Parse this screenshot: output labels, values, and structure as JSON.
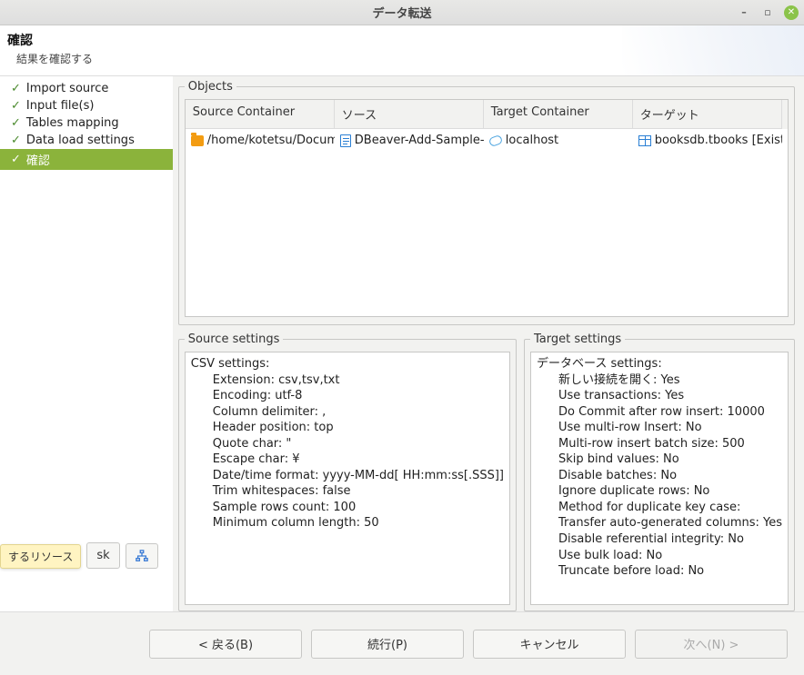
{
  "window": {
    "title": "データ転送"
  },
  "header": {
    "title": "確認",
    "subtitle": "結果を確認する"
  },
  "sidebar": {
    "items": [
      {
        "label": "Import source",
        "active": false
      },
      {
        "label": "Input file(s)",
        "active": false
      },
      {
        "label": "Tables mapping",
        "active": false
      },
      {
        "label": "Data load settings",
        "active": false
      },
      {
        "label": "確認",
        "active": true
      }
    ],
    "tooltip": "するリソース",
    "sk_button": "sk",
    "tool_icon": "sitemap-icon"
  },
  "objects": {
    "legend": "Objects",
    "columns": [
      "Source Container",
      "ソース",
      "Target Container",
      "ターゲット"
    ],
    "rows": [
      {
        "source_container": "/home/kotetsu/Docum",
        "source": "DBeaver-Add-Sample-",
        "target_container": "localhost",
        "target": "booksdb.tbooks [Existin"
      }
    ]
  },
  "source_settings": {
    "legend": "Source settings",
    "title": "CSV settings:",
    "lines": [
      "Extension: csv,tsv,txt",
      "Encoding: utf-8",
      "Column delimiter: ,",
      "Header position: top",
      "Quote char: \"",
      "Escape char: ¥",
      "Date/time format: yyyy-MM-dd[ HH:mm:ss[.SSS]]",
      "Trim whitespaces: false",
      "Sample rows count: 100",
      "Minimum column length: 50"
    ]
  },
  "target_settings": {
    "legend": "Target settings",
    "title": "データベース settings:",
    "lines": [
      "新しい接続を開く: Yes",
      "Use transactions: Yes",
      "Do Commit after row insert: 10000",
      "Use multi-row Insert: No",
      "Multi-row insert batch size: 500",
      "Skip bind values: No",
      "Disable batches: No",
      "Ignore duplicate rows: No",
      "Method for duplicate key case:",
      "Transfer auto-generated columns: Yes",
      "Disable referential integrity: No",
      "Use bulk load: No",
      "Truncate before load: No"
    ]
  },
  "footer": {
    "back": "< 戻る(B)",
    "continue": "続行(P)",
    "cancel": "キャンセル",
    "next": "次へ(N) >"
  }
}
